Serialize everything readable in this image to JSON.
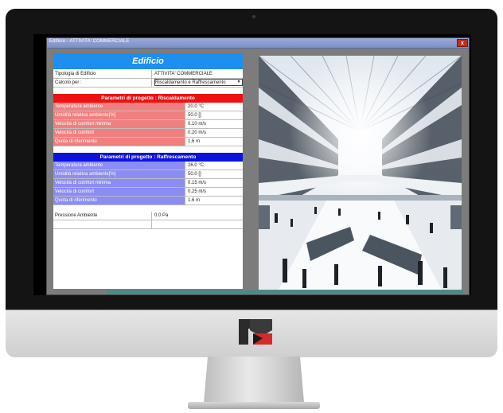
{
  "window": {
    "title": "Edificio - ATTIVITA' COMMERCIALE",
    "close_label": "x"
  },
  "form": {
    "header": "Edificio",
    "tipologia": {
      "label": "Tipologia di Edificio",
      "value": "ATTIVITA' COMMERCIALE"
    },
    "calcolo": {
      "label": "Calcolo per :",
      "value": "Riscaldamento e Raffrescamento"
    }
  },
  "riscaldamento": {
    "header": "Parametri di progetto : Riscaldamento",
    "rows": [
      {
        "label": "Temperatura ambiente",
        "value": "20.0 °C"
      },
      {
        "label": "Umidità relativa ambiente[%]",
        "value": "50.0 []"
      },
      {
        "label": "Velocità di comfort minima",
        "value": "0.10 m/s"
      },
      {
        "label": "Velocità di comfort",
        "value": "0.20 m/s"
      },
      {
        "label": "Quota di riferimento",
        "value": "1.6 m"
      }
    ]
  },
  "raffrescamento": {
    "header": "Parametri di progetto : Raffrescamento",
    "rows": [
      {
        "label": "Temperatura ambiente",
        "value": "26.0 °C"
      },
      {
        "label": "Umidità relativa ambiente[%]",
        "value": "50.0 []"
      },
      {
        "label": "Velocità di comfort minima",
        "value": "0.15 m/s"
      },
      {
        "label": "Velocità di comfort",
        "value": "0.25 m/s"
      },
      {
        "label": "Quota di riferimento",
        "value": "1.6 m"
      }
    ]
  },
  "pressione": {
    "label": "Pressione Ambiente",
    "value": "0.0 Pa"
  },
  "colors": {
    "header_blue": "#1e8ef0",
    "heating_header": "#ee1111",
    "heating_row": "#f08080",
    "cooling_header": "#0c14dc",
    "cooling_row": "#8c8cf5",
    "titlebar": "#7d8fc6",
    "close_red": "#c42b1c"
  },
  "icons": {
    "dropdown": "chevron-down-icon",
    "close": "close-icon",
    "brand": "brand-logo-icon"
  }
}
